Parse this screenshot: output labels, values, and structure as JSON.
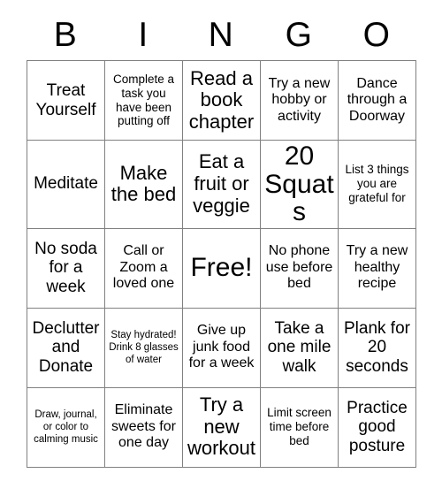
{
  "card": {
    "title": "BINGO",
    "header_letters": [
      "B",
      "I",
      "N",
      "G",
      "O"
    ],
    "border_color": "#808080",
    "text_color": "#000000",
    "background_color": "#ffffff",
    "columns": 5,
    "rows": 5,
    "free_space": {
      "row": 3,
      "column": 3,
      "label": "Free!"
    },
    "cells": [
      [
        {
          "text": "Treat Yourself",
          "size": "lg"
        },
        {
          "text": "Complete a task you have been putting off",
          "size": "sm"
        },
        {
          "text": "Read a book chapter",
          "size": "xl"
        },
        {
          "text": "Try a new hobby or activity",
          "size": "md"
        },
        {
          "text": "Dance through a Doorway",
          "size": "md"
        }
      ],
      [
        {
          "text": "Meditate",
          "size": "lg"
        },
        {
          "text": "Make the bed",
          "size": "xl"
        },
        {
          "text": "Eat a fruit or veggie",
          "size": "xl"
        },
        {
          "text": "20 Squats",
          "size": "xxl"
        },
        {
          "text": "List 3 things you are grateful for",
          "size": "sm"
        }
      ],
      [
        {
          "text": "No soda for a week",
          "size": "lg"
        },
        {
          "text": "Call or Zoom a loved one",
          "size": "md"
        },
        {
          "text": "Free!",
          "size": "xxl"
        },
        {
          "text": "No phone use before bed",
          "size": "md"
        },
        {
          "text": "Try a new healthy recipe",
          "size": "md"
        }
      ],
      [
        {
          "text": "Declutter and Donate",
          "size": "lg"
        },
        {
          "text": "Stay hydrated! Drink 8 glasses of water",
          "size": "xs"
        },
        {
          "text": "Give up junk food for a week",
          "size": "md"
        },
        {
          "text": "Take a one mile walk",
          "size": "lg"
        },
        {
          "text": "Plank for 20 seconds",
          "size": "lg"
        }
      ],
      [
        {
          "text": "Draw, journal, or color to calming music",
          "size": "xs"
        },
        {
          "text": "Eliminate sweets for one day",
          "size": "md"
        },
        {
          "text": "Try a new workout",
          "size": "xl"
        },
        {
          "text": "Limit screen time before bed",
          "size": "sm"
        },
        {
          "text": "Practice good posture",
          "size": "lg"
        }
      ]
    ]
  }
}
